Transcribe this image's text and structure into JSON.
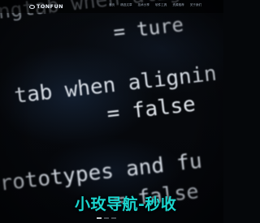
{
  "header": {
    "logo_text": "TONFUN",
    "logo_icon": "eye-logo-icon",
    "nav": [
      "首页",
      "精选文章",
      "技术分享",
      "软件工具",
      "资源推荐",
      "关于我们"
    ]
  },
  "background_code": {
    "line1_text": "ngtab when aligning",
    "line1_value": "= ture",
    "line2_text": "tab when alignin",
    "line2_value": "= false",
    "line3_text": "rototypes and fu",
    "line3_value": "= false"
  },
  "overlay": {
    "title": "小玫导航-秒收"
  },
  "carousel": {
    "slide_count": 3,
    "active_index": 0
  },
  "colors": {
    "accent": "#1ad6cf",
    "background": "#06080c",
    "code_text": "#d5dbe3"
  }
}
